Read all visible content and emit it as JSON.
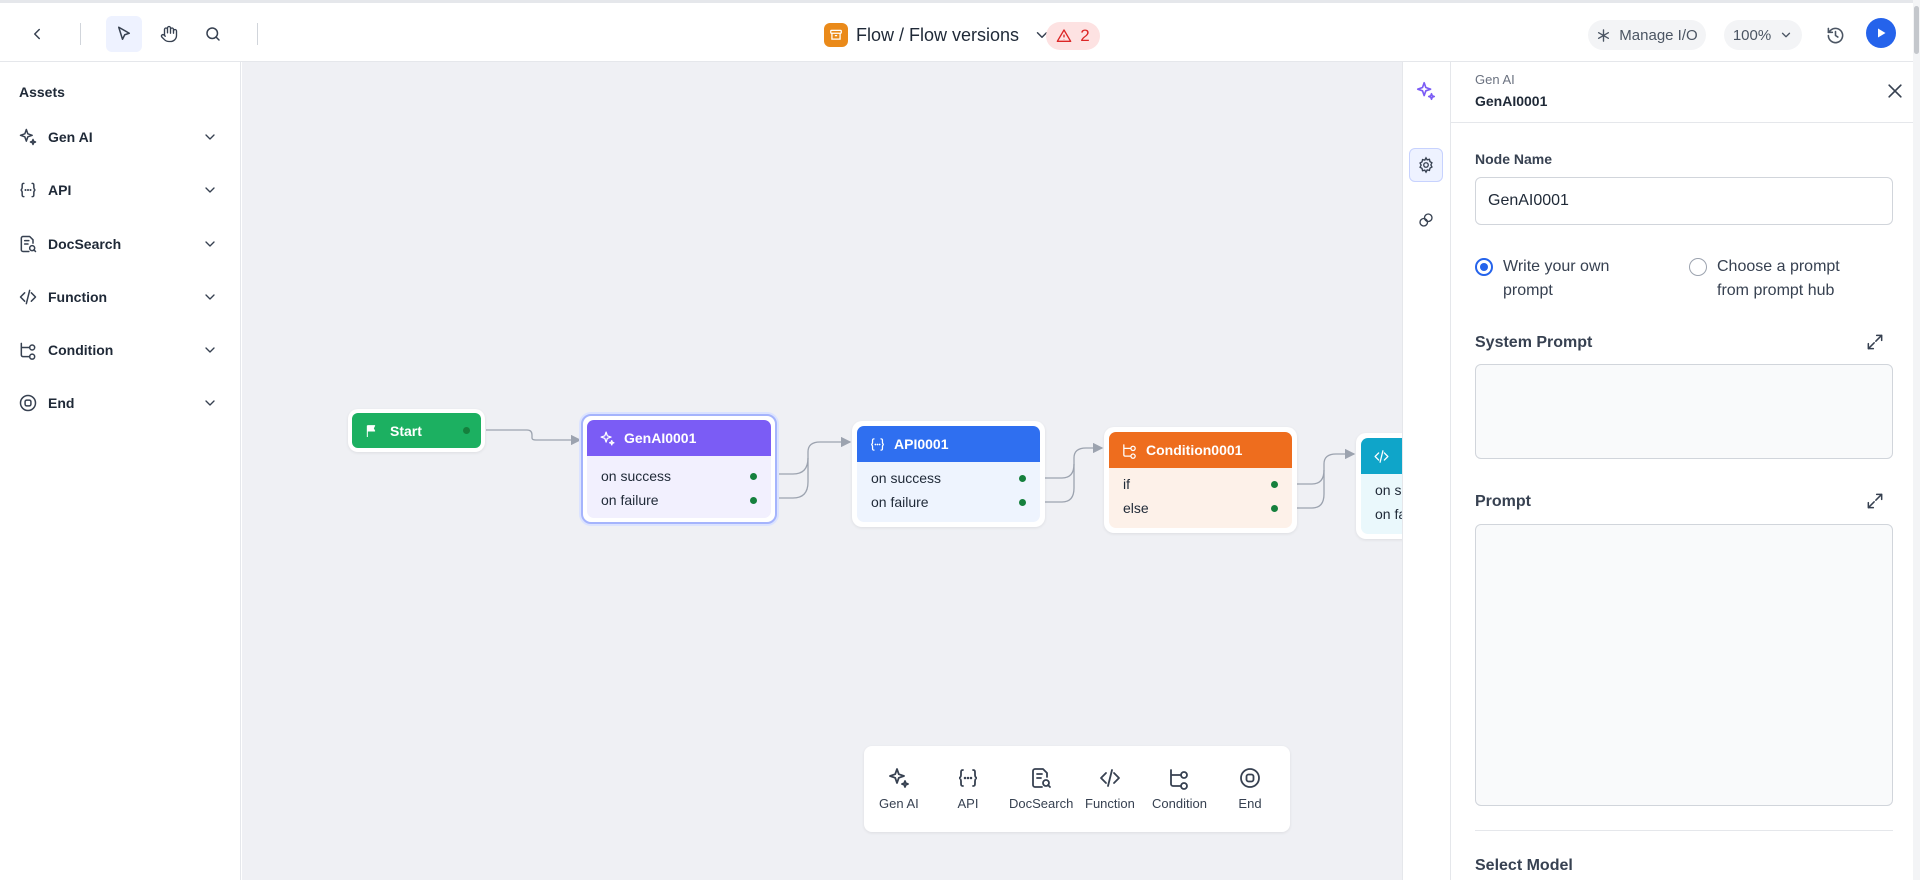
{
  "topbar": {
    "title": "Flow / Flow versions",
    "warnings_count": "2",
    "manage_io_label": "Manage I/O",
    "zoom_label": "100%"
  },
  "sidebar": {
    "title": "Assets",
    "items": [
      {
        "label": "Gen AI",
        "icon": "sparkles-icon"
      },
      {
        "label": "API",
        "icon": "braces-icon"
      },
      {
        "label": "DocSearch",
        "icon": "doc-search-icon"
      },
      {
        "label": "Function",
        "icon": "code-icon"
      },
      {
        "label": "Condition",
        "icon": "branch-icon"
      },
      {
        "label": "End",
        "icon": "stop-circle-icon"
      }
    ]
  },
  "canvas": {
    "nodes": {
      "start": {
        "title": "Start"
      },
      "genai": {
        "title": "GenAI0001",
        "ports": [
          "on success",
          "on failure"
        ]
      },
      "api": {
        "title": "API0001",
        "ports": [
          "on success",
          "on failure"
        ]
      },
      "condition": {
        "title": "Condition0001",
        "ports": [
          "if",
          "else"
        ]
      },
      "function": {
        "ports": [
          "on s",
          "on fa"
        ]
      }
    },
    "palette": [
      {
        "label": "Gen AI",
        "icon": "sparkles-icon"
      },
      {
        "label": "API",
        "icon": "braces-icon"
      },
      {
        "label": "DocSearch",
        "icon": "doc-search-icon"
      },
      {
        "label": "Function",
        "icon": "code-icon"
      },
      {
        "label": "Condition",
        "icon": "branch-icon"
      },
      {
        "label": "End",
        "icon": "stop-circle-icon"
      }
    ]
  },
  "panel": {
    "type_label": "Gen AI",
    "node_id": "GenAI0001",
    "node_name_label": "Node Name",
    "node_name_value": "GenAI0001",
    "radio_own_line1": "Write your own",
    "radio_own_line2": "prompt",
    "radio_hub_line1": "Choose a prompt",
    "radio_hub_line2": "from prompt hub",
    "system_prompt_label": "System Prompt",
    "prompt_label": "Prompt",
    "select_model_label": "Select Model"
  },
  "colors": {
    "start": "#1cb061",
    "genai": "#7b5cf5",
    "api": "#2f6ff0",
    "condition": "#ee6d1e",
    "function": "#0fa5c9",
    "accent": "#2563eb"
  }
}
